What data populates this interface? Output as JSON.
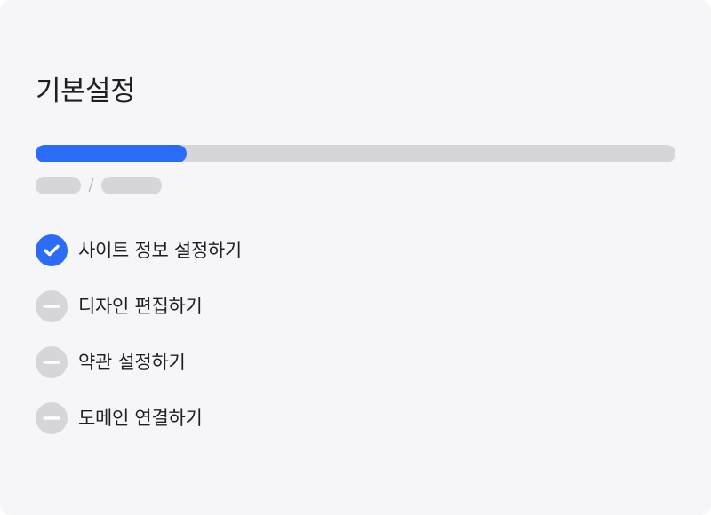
{
  "setup": {
    "title": "기본설정",
    "progress": {
      "completed_steps": 1,
      "total_steps": 4,
      "fraction": 0.236
    },
    "steps": [
      {
        "label": "사이트 정보 설정하기",
        "status": "done",
        "icon": "check-circle-icon"
      },
      {
        "label": "디자인 편집하기",
        "status": "todo",
        "icon": "minus-circle-icon"
      },
      {
        "label": "약관 설정하기",
        "status": "todo",
        "icon": "minus-circle-icon"
      },
      {
        "label": "도메인 연결하기",
        "status": "todo",
        "icon": "minus-circle-icon"
      }
    ]
  },
  "colors": {
    "accent": "#2a6cf6",
    "track": "#d6d6da",
    "background": "#f6f6f8",
    "text": "#1f1f22"
  }
}
